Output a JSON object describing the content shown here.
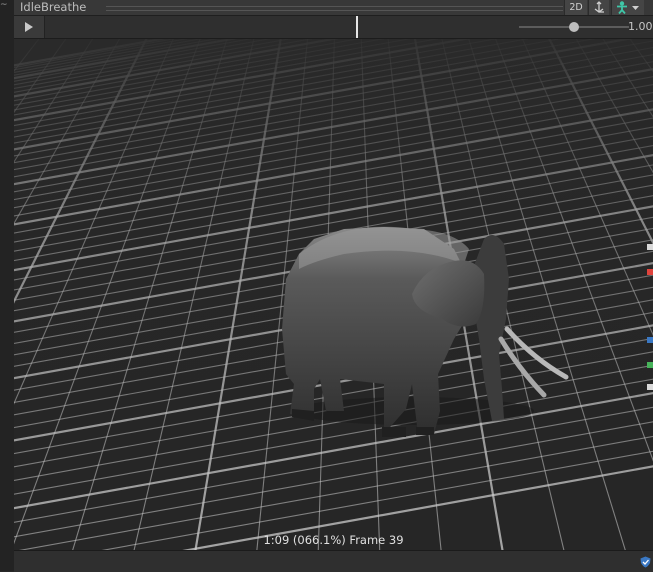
{
  "window": {
    "title": "IdleBreathe"
  },
  "toolbar": {
    "mode_2d_label": "2D",
    "pivot_icon": "pivot-icon",
    "avatar_icon": "avatar-icon"
  },
  "timeline": {
    "play_icon": "play-icon",
    "speed_value": "1.00",
    "playhead_fraction": 0.66,
    "speed_fraction": 0.5
  },
  "viewport": {
    "status": "1:09 (066.1%) Frame 39",
    "preview_subject": "elephant"
  },
  "footer": {
    "icon": "shield-icon"
  },
  "colors": {
    "background": "#282828",
    "panel": "#383838",
    "grid_line": "#cfcfcf",
    "accent_blue": "#3a78c4"
  }
}
